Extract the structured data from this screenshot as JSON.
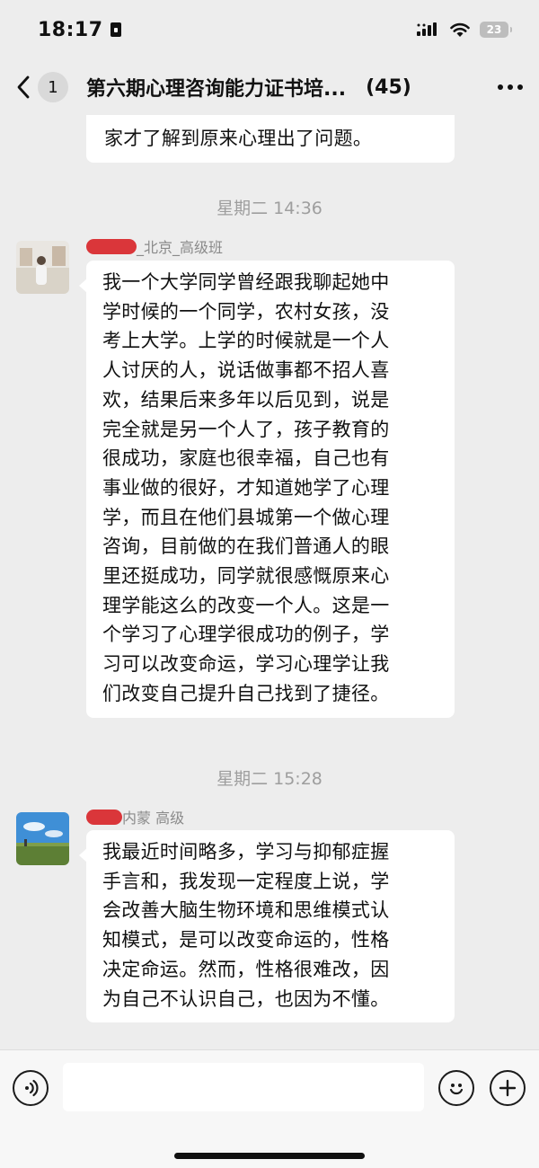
{
  "status": {
    "time": "18:17",
    "battery": "23"
  },
  "header": {
    "back_count": "1",
    "title": "第六期心理咨询能力证书培...",
    "member_count": "(45)"
  },
  "chat": {
    "partial_message": "家才了解到原来心理出了问题。",
    "messages": [
      {
        "time": "星期二 14:36",
        "sender": "_北京_高级班",
        "lines": [
          "我一个大学同学曾经跟我聊起她中",
          "学时候的一个同学，农村女孩，没",
          "考上大学。上学的时候就是一个人",
          "人讨厌的人，说话做事都不招人喜",
          "欢，结果后来多年以后见到，说是",
          "完全就是另一个人了，孩子教育的",
          "很成功，家庭也很幸福，自己也有",
          "事业做的很好，才知道她学了心理",
          "学，而且在他们县城第一个做心理",
          "咨询，目前做的在我们普通人的眼",
          "里还挺成功，同学就很感慨原来心",
          "理学能这么的改变一个人。这是一",
          "个学习了心理学很成功的例子，学",
          "习可以改变命运，学习心理学让我",
          "们改变自己提升自己找到了捷径。"
        ]
      },
      {
        "time": "星期二 15:28",
        "sender": "内蒙  高级",
        "lines": [
          "我最近时间略多，学习与抑郁症握",
          "手言和，我发现一定程度上说，学",
          "会改善大脑生物环境和思维模式认",
          "知模式，是可以改变命运的，性格",
          "决定命运。然而，性格很难改，因",
          "为自己不认识自己，也因为不懂。"
        ]
      }
    ]
  },
  "input": {
    "value": ""
  },
  "icons": {
    "status": [
      "lock-icon",
      "signal-icon",
      "wifi-icon",
      "battery-icon"
    ],
    "header": [
      "back-chevron-icon",
      "more-icon"
    ],
    "input_bar": [
      "voice-icon",
      "emoji-icon",
      "plus-icon"
    ]
  },
  "colors": {
    "background": "#ededed",
    "bubble": "#ffffff",
    "timestamp": "#9e9e9e",
    "redaction": "#d8262a"
  }
}
